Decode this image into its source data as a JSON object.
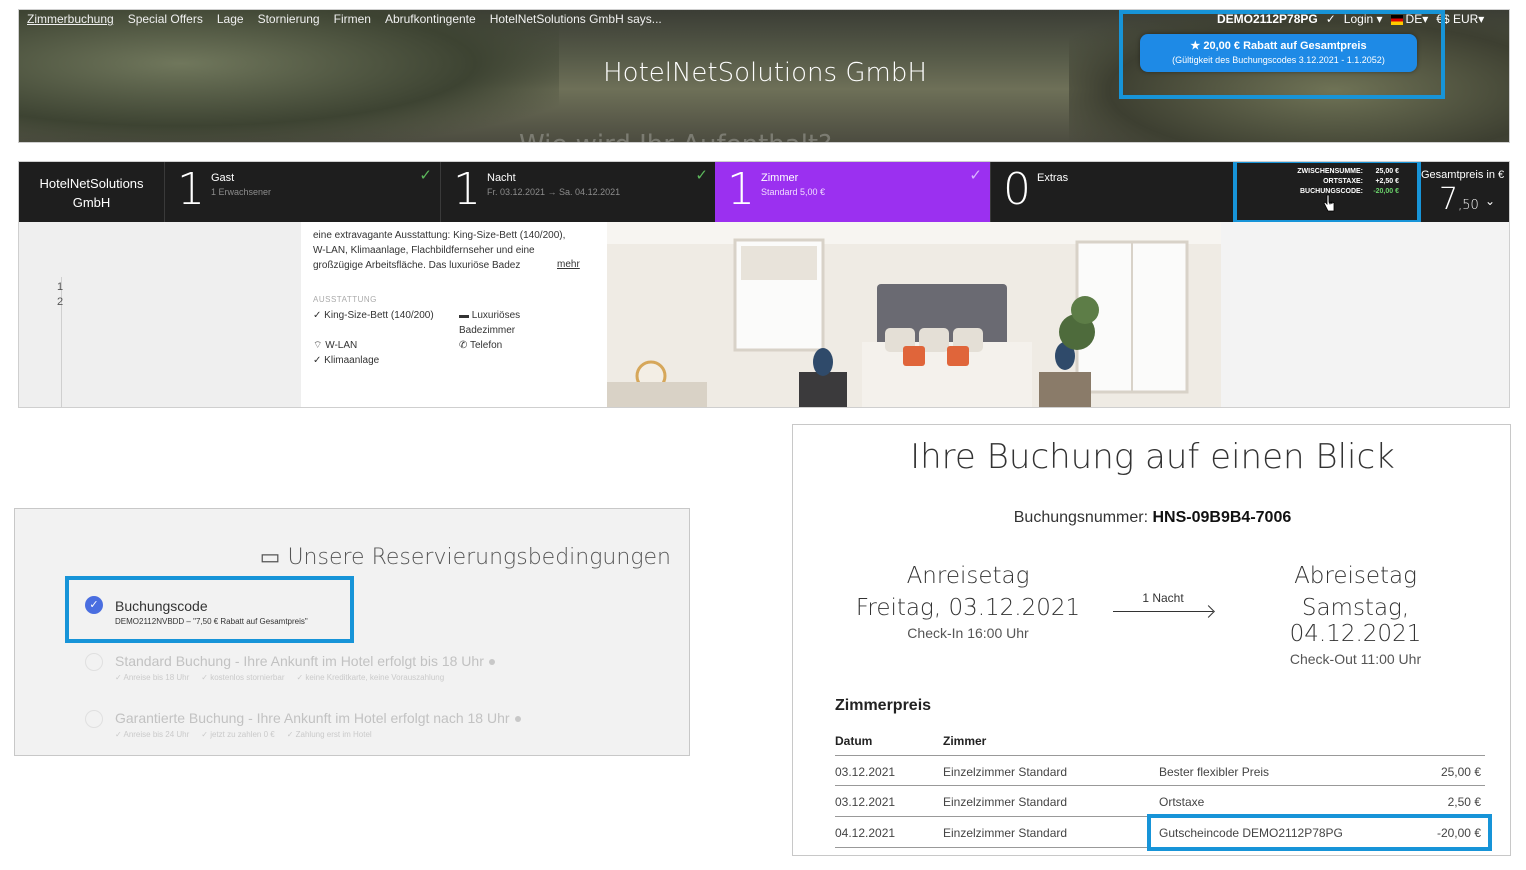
{
  "header": {
    "nav": [
      "Zimmerbuchung",
      "Special Offers",
      "Lage",
      "Stornierung",
      "Firmen",
      "Abrufkontingente",
      "HotelNetSolutions GmbH says..."
    ],
    "title": "HotelNetSolutions GmbH",
    "booking_code": "DEMO2112P78PG",
    "login": "Login",
    "language": "DE",
    "currency": "EUR",
    "currency_symbol": "€$",
    "promo_line1": "20,00 € Rabatt auf Gesamtpreis",
    "promo_line2": "(Gültigkeit des Buchungscodes 3.12.2021 - 1.1.2052)"
  },
  "booking_bar": {
    "brand": "HotelNetSolutions GmbH",
    "segments": [
      {
        "count": "1",
        "label": "Gast",
        "sub": "1 Erwachsener"
      },
      {
        "count": "1",
        "label": "Nacht",
        "sub": "Fr. 03.12.2021 → Sa. 04.12.2021"
      },
      {
        "count": "1",
        "label": "Zimmer",
        "sub": "Standard 5,00 €"
      },
      {
        "count": "0",
        "label": "Extras",
        "sub": ""
      }
    ],
    "sums": [
      {
        "label": "ZWISCHENSUMME:",
        "value": "25,00 €"
      },
      {
        "label": "ORTSTAXE:",
        "value": "+2,50 €"
      },
      {
        "label": "BUCHUNGSCODE:",
        "value": "-20,00 €"
      }
    ],
    "total_label": "Gesamtpreis in €",
    "total_int": "7",
    "total_dec": ",50",
    "description_l1": "eine extravagante Ausstattung: King-Size-Bett (140/200),",
    "description_l2": "W-LAN, Klimaanlage, Flachbildfernseher und eine",
    "description_l3": "großzügige Arbeitsfläche. Das luxuriöse Badez",
    "more": "mehr",
    "amenities_heading": "AUSSTATTUNG",
    "amenities": [
      "King-Size-Bett (140/200)",
      "W-LAN",
      "Klimaanlage",
      "Luxuriöses Badezimmer",
      "Telefon"
    ],
    "side_nums": [
      "1",
      "2"
    ]
  },
  "conditions": {
    "heading": "Unsere Reservierungsbedingungen",
    "selected_title": "Buchungscode",
    "selected_sub": "DEMO2112NVBDD – \"7,50 € Rabatt auf Gesamtpreis\"",
    "options": [
      {
        "title": "Standard Buchung - Ihre Ankunft im Hotel erfolgt bis 18 Uhr",
        "notes": [
          "✓ Anreise bis 18 Uhr",
          "✓ kostenlos stornierbar",
          "✓ keine Kreditkarte, keine Vorauszahlung"
        ]
      },
      {
        "title": "Garantierte Buchung - Ihre Ankunft im Hotel erfolgt nach 18 Uhr",
        "notes": [
          "✓ Anreise bis 24 Uhr",
          "✓ jetzt zu zahlen 0 €",
          "✓ Zahlung erst im Hotel"
        ]
      }
    ]
  },
  "summary": {
    "title": "Ihre Buchung auf einen Blick",
    "number_label": "Buchungsnummer:",
    "number": "HNS-09B9B4-7006",
    "arrival_label": "Anreisetag",
    "arrival_date": "Freitag, 03.12.2021",
    "checkin": "Check-In 16:00 Uhr",
    "nights": "1 Nacht",
    "departure_label": "Abreisetag",
    "departure_date": "Samstag, 04.12.2021",
    "checkout": "Check-Out 11:00 Uhr",
    "section": "Zimmerpreis",
    "col_date": "Datum",
    "col_room": "Zimmer",
    "rows": [
      {
        "date": "03.12.2021",
        "room": "Einzelzimmer Standard",
        "desc": "Bester flexibler Preis",
        "amount": "25,00 €"
      },
      {
        "date": "03.12.2021",
        "room": "Einzelzimmer Standard",
        "desc": "Ortstaxe",
        "amount": "2,50 €"
      },
      {
        "date": "04.12.2021",
        "room": "Einzelzimmer Standard",
        "desc": "Gutscheincode DEMO2112P78PG",
        "amount": "-20,00 €"
      }
    ]
  },
  "colors": {
    "highlight": "#1794d8",
    "room_accent": "#9b30f0",
    "promo": "#1e8ae6",
    "radio": "#4a6ee0"
  }
}
